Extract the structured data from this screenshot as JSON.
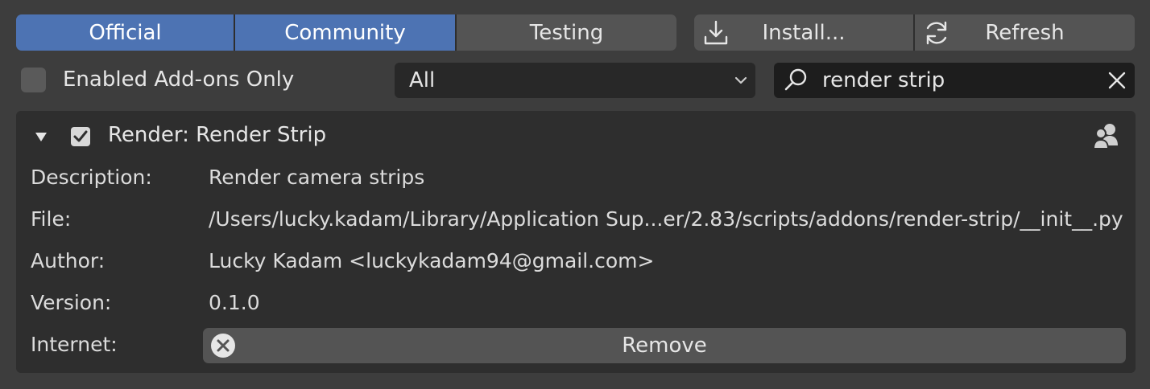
{
  "tabs": [
    {
      "label": "Official",
      "active": true
    },
    {
      "label": "Community",
      "active": true
    },
    {
      "label": "Testing",
      "active": false
    }
  ],
  "actions": {
    "install_label": "Install...",
    "install_icon": "download-icon",
    "refresh_label": "Refresh",
    "refresh_icon": "refresh-icon"
  },
  "filters": {
    "enabled_only_label": "Enabled Add-ons Only",
    "enabled_only_checked": false,
    "category_value": "All",
    "search_value": "render strip"
  },
  "addon": {
    "title": "Render: Render Strip",
    "expanded": true,
    "enabled": true,
    "type_icon": "community-users-icon",
    "rows": [
      {
        "label": "Description:",
        "value": "Render camera strips"
      },
      {
        "label": "File:",
        "value": "/Users/lucky.kadam/Library/Application Sup...er/2.83/scripts/addons/render-strip/__init__.py"
      },
      {
        "label": "Author:",
        "value": "Lucky Kadam <luckykadam94@gmail.com>"
      },
      {
        "label": "Version:",
        "value": "0.1.0"
      }
    ],
    "internet_label": "Internet:",
    "remove_label": "Remove"
  },
  "colors": {
    "accent": "#4d73b3",
    "background": "#3d3d3d",
    "panel": "#2e2e2e",
    "button": "#545454"
  }
}
